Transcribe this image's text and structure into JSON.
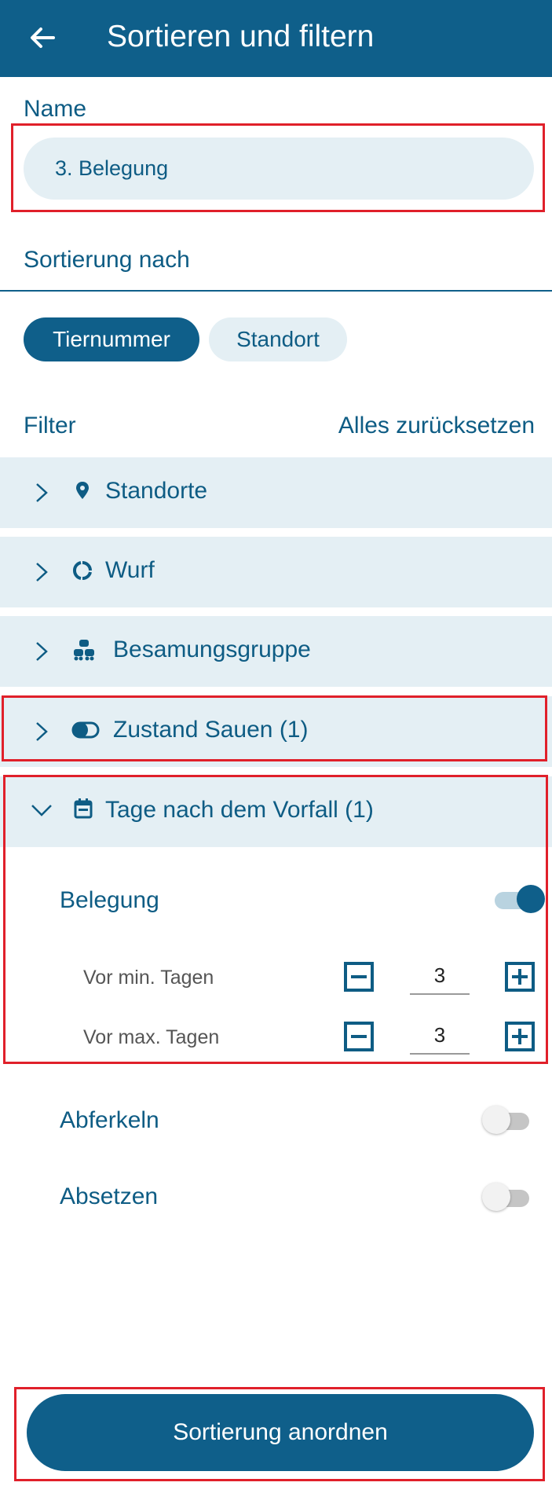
{
  "header": {
    "title": "Sortieren und filtern"
  },
  "name_field": {
    "label": "Name",
    "value": "3. Belegung"
  },
  "sort": {
    "label": "Sortierung nach",
    "options": [
      {
        "label": "Tiernummer",
        "selected": true
      },
      {
        "label": "Standort",
        "selected": false
      }
    ]
  },
  "filter": {
    "label": "Filter",
    "reset_label": "Alles zurücksetzen",
    "sections": [
      {
        "label": "Standorte",
        "icon": "location-pin-icon",
        "expanded": false
      },
      {
        "label": "Wurf",
        "icon": "circle-arrows-icon",
        "expanded": false
      },
      {
        "label": "Besamungsgruppe",
        "icon": "pig-group-icon",
        "expanded": false
      },
      {
        "label": "Zustand Sauen (1)",
        "icon": "toggle-icon",
        "expanded": false
      },
      {
        "label": "Tage nach dem Vorfall (1)",
        "icon": "calendar-icon",
        "expanded": true
      }
    ]
  },
  "events": {
    "belegung": {
      "label": "Belegung",
      "enabled": true,
      "min": {
        "label": "Vor min. Tagen",
        "value": "3"
      },
      "max": {
        "label": "Vor max. Tagen",
        "value": "3"
      }
    },
    "abferkeln": {
      "label": "Abferkeln",
      "enabled": false
    },
    "absetzen": {
      "label": "Absetzen",
      "enabled": false
    }
  },
  "submit_label": "Sortierung anordnen",
  "colors": {
    "primary": "#0f5f8a",
    "light": "#e4eff4",
    "highlight": "#e0202a"
  }
}
